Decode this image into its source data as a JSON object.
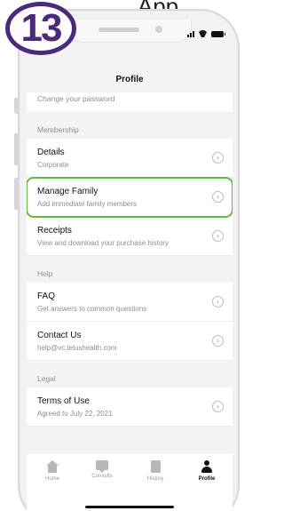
{
  "step_badge": "13",
  "top_fragment": "App",
  "nav": {
    "title": "Profile"
  },
  "cutoff_row": {
    "subtitle": "Change your password"
  },
  "sections": {
    "membership": {
      "header": "Membership",
      "items": [
        {
          "title": "Details",
          "subtitle": "Corporate"
        },
        {
          "title": "Manage Family",
          "subtitle": "Add immediate family members"
        },
        {
          "title": "Receipts",
          "subtitle": "View and download your purchase history"
        }
      ]
    },
    "help": {
      "header": "Help",
      "items": [
        {
          "title": "FAQ",
          "subtitle": "Get answers to common questions"
        },
        {
          "title": "Contact Us",
          "subtitle": "help@vc.telushealth.com"
        }
      ]
    },
    "legal": {
      "header": "Legal",
      "items": [
        {
          "title": "Terms of Use",
          "subtitle": "Agreed to July 22, 2021"
        }
      ]
    }
  },
  "chevron_glyph": "›",
  "tabs": [
    {
      "label": "Home",
      "icon": "home-icon"
    },
    {
      "label": "Consults",
      "icon": "consults-icon"
    },
    {
      "label": "History",
      "icon": "history-icon"
    },
    {
      "label": "Profile",
      "icon": "profile-icon",
      "active": true
    }
  ],
  "colors": {
    "badge": "#4b2a7b",
    "highlight": "#66bc40",
    "text_primary": "#111111",
    "text_secondary": "#8e8e93"
  }
}
